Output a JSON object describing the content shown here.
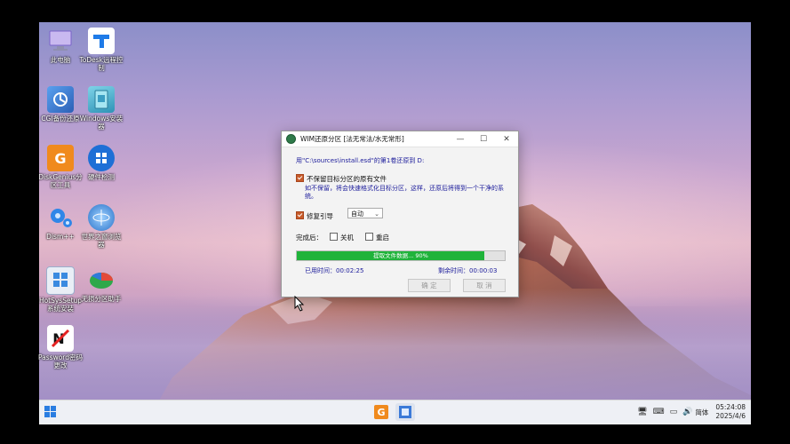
{
  "desktop": {
    "icons": [
      {
        "label": "此电脑",
        "icon": "computer-icon"
      },
      {
        "label": "ToDesk远程控制",
        "icon": "todesk-icon"
      },
      {
        "label": "CGI备份还原",
        "icon": "cgi-icon"
      },
      {
        "label": "Windows安装器",
        "icon": "windows-installer-icon"
      },
      {
        "label": "DiskGenius分区工具",
        "icon": "diskgenius-icon"
      },
      {
        "label": "硬件检测",
        "icon": "hardware-icon"
      },
      {
        "label": "Dism++",
        "icon": "dism-icon"
      },
      {
        "label": "世界之窗浏览器",
        "icon": "browser-icon"
      },
      {
        "label": "HotSysSetup系统安装",
        "icon": "setup-icon"
      },
      {
        "label": "无损分区助手",
        "icon": "partition-icon"
      },
      {
        "label": "Password密码更改",
        "icon": "password-icon"
      }
    ]
  },
  "dialog": {
    "title": "WIM还原分区  [法无常法/水无常形]",
    "minimize": "—",
    "maximize": "☐",
    "close": "✕",
    "source_line": "用\"C:\\sources\\install.esd\"的第1卷还原到 D:",
    "keep_files": {
      "label": "不保留目标分区的原有文件",
      "checked": true
    },
    "keep_files_desc": "如不保留，将会快速格式化目标分区，这样，还原后将得到一个干净的系统。",
    "repair_boot": {
      "label": "修复引导",
      "checked": true
    },
    "boot_mode": "自动",
    "after_label": "完成后：",
    "shutdown": {
      "label": "关机",
      "checked": false
    },
    "restart": {
      "label": "重启",
      "checked": false
    },
    "progress": {
      "text": "提取文件数据...  90%",
      "value": 0.9
    },
    "elapsed": "已用时间：00:02:25",
    "remaining": "剩余时间：00:00:03",
    "ok_label": "确 定",
    "cancel_label": "取 消"
  },
  "taskbar": {
    "tray_language": "简体",
    "time": "05:24:08",
    "date": "2025/4/6"
  },
  "colors": {
    "progress_fill": "#1fb33a",
    "link_text": "#1a1a9a",
    "checkbox_on": "#c75b2a"
  }
}
